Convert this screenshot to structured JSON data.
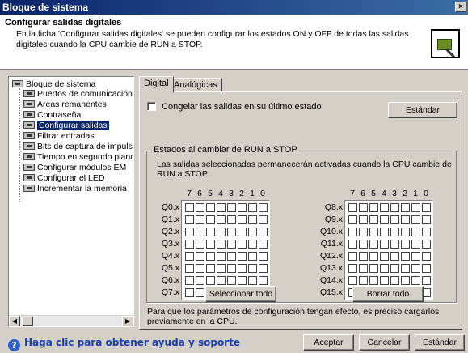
{
  "window": {
    "title": "Bloque de sistema",
    "close_glyph": "×"
  },
  "header": {
    "title": "Configurar salidas digitales",
    "description": "En la ficha 'Configurar salidas digitales' se pueden configurar los estados ON y OFF de todas las salidas digitales cuando la CPU cambie de RUN a STOP.",
    "icon": "plc-module-icon"
  },
  "tree": {
    "root": "Bloque de sistema",
    "items": [
      "Puertos de comunicación",
      "Áreas remanentes",
      "Contraseña",
      "Configurar salidas",
      "Filtrar entradas",
      "Bits de captura de impulsos",
      "Tiempo en segundo plano",
      "Configurar módulos EM",
      "Configurar el LED",
      "Incrementar la memoria"
    ],
    "selected_index": 3
  },
  "tabs": {
    "digital": "Digital",
    "analog": "Analógicas"
  },
  "freeze": {
    "label": "Congelar las salidas en su último estado",
    "checked": false
  },
  "standard_btn": "Estándar",
  "group": {
    "title": "Estados al cambiar de RUN a STOP",
    "info": "Las salidas seleccionadas permanecerán activadas cuando la CPU cambie de RUN a STOP.",
    "bits": [
      "7",
      "6",
      "5",
      "4",
      "3",
      "2",
      "1",
      "0"
    ],
    "left_rows": [
      "Q0.x",
      "Q1.x",
      "Q2.x",
      "Q3.x",
      "Q4.x",
      "Q5.x",
      "Q6.x",
      "Q7.x"
    ],
    "right_rows": [
      "Q8.x",
      "Q9.x",
      "Q10.x",
      "Q11.x",
      "Q12.x",
      "Q13.x",
      "Q14.x",
      "Q15.x"
    ],
    "select_all": "Seleccionar todo",
    "clear_all": "Borrar todo"
  },
  "note": "Para que los parámetros de configuración tengan efecto, es preciso cargarlos previamente en la CPU.",
  "footer": {
    "help_text": "Haga clic para obtener ayuda y soporte",
    "ok": "Aceptar",
    "cancel": "Cancelar",
    "default": "Estándar"
  }
}
